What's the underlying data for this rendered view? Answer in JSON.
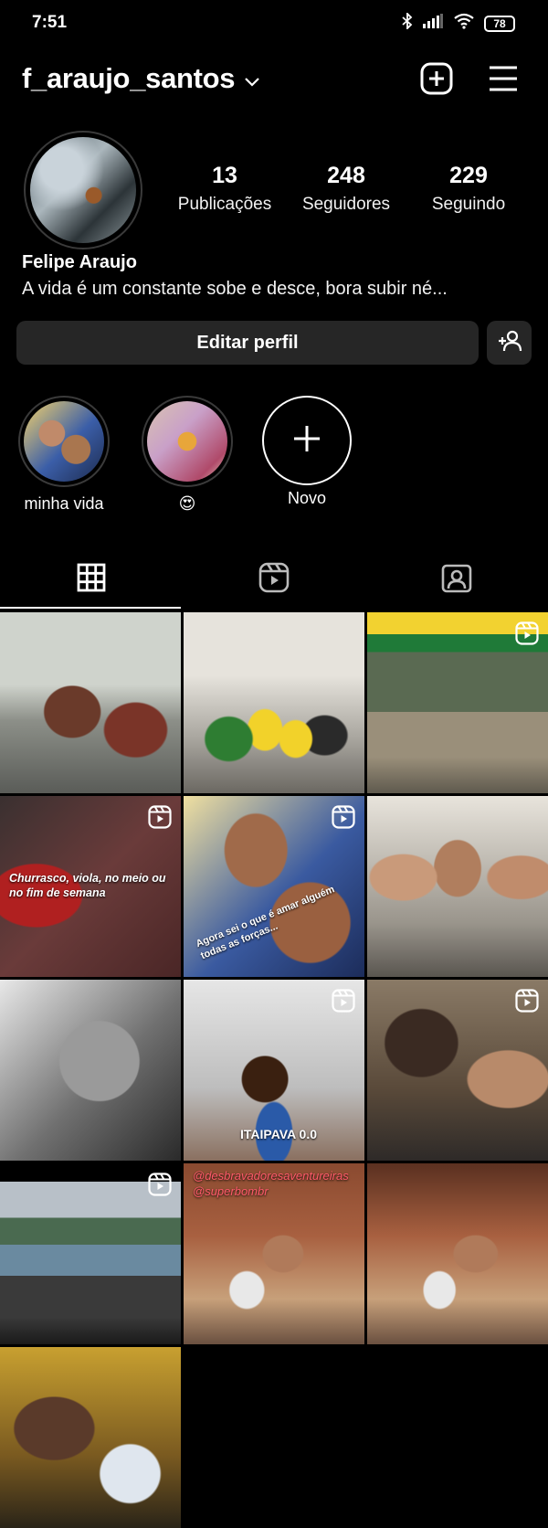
{
  "status_bar": {
    "time": "7:51",
    "battery": "78"
  },
  "header": {
    "username": "f_araujo_santos"
  },
  "profile": {
    "stats": [
      {
        "value": "13",
        "label": "Publicações"
      },
      {
        "value": "248",
        "label": "Seguidores"
      },
      {
        "value": "229",
        "label": "Seguindo"
      }
    ],
    "name": "Felipe Araujo",
    "bio": "A vida é um constante sobe e desce, bora subir né...",
    "edit_label": "Editar perfil"
  },
  "highlights": [
    {
      "label": "minha vida"
    },
    {
      "label": "😍"
    },
    {
      "label": "Novo"
    }
  ],
  "tabs": [
    {
      "icon": "grid-icon"
    },
    {
      "icon": "reels-icon"
    },
    {
      "icon": "tagged-icon"
    }
  ],
  "posts": [
    {
      "type": "photo"
    },
    {
      "type": "photo"
    },
    {
      "type": "reel"
    },
    {
      "type": "reel",
      "caption": "Churrasco, viola, no meio ou no fim de semana"
    },
    {
      "type": "reel",
      "caption": "Agora sei o que é amar alguém todas as forças..."
    },
    {
      "type": "photo"
    },
    {
      "type": "photo"
    },
    {
      "type": "reel",
      "caption": "ITAIPAVA 0.0"
    },
    {
      "type": "reel"
    },
    {
      "type": "reel"
    },
    {
      "type": "photo",
      "caption": "@desbravadoresaventureiras @superbombr"
    },
    {
      "type": "photo"
    },
    {
      "type": "photo"
    }
  ]
}
